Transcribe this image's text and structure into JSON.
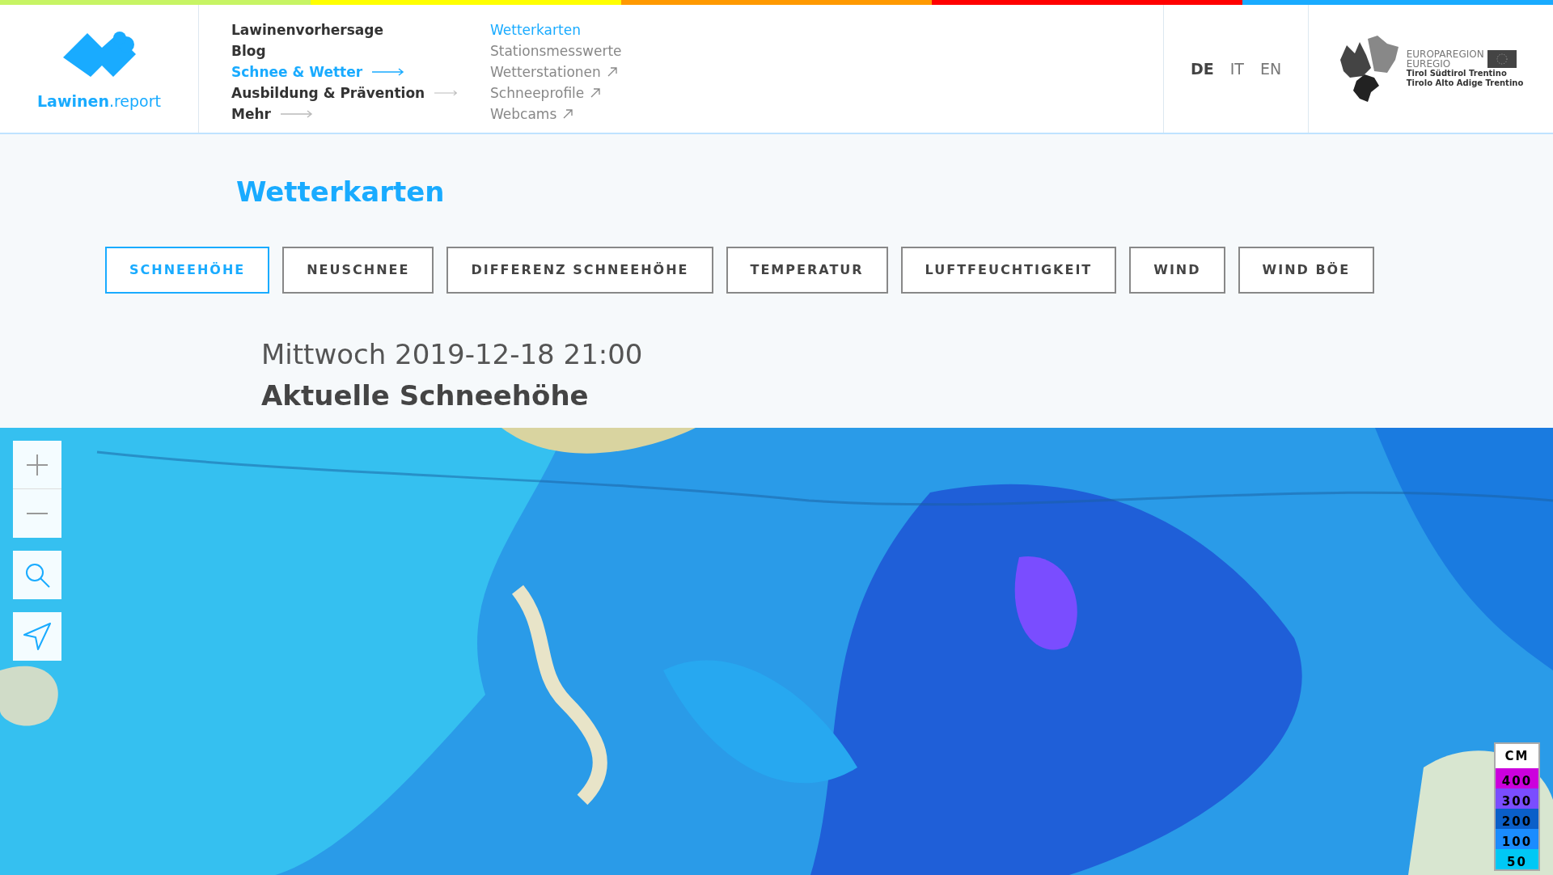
{
  "brand": {
    "name_bold": "Lawinen",
    "name_light": ".report"
  },
  "nav_main": [
    {
      "label": "Lawinenvorhersage",
      "selected": false,
      "arrow": false
    },
    {
      "label": "Blog",
      "selected": false,
      "arrow": false
    },
    {
      "label": "Schnee & Wetter",
      "selected": true,
      "arrow": true
    },
    {
      "label": "Ausbildung & Prävention",
      "selected": false,
      "arrow": true
    },
    {
      "label": "Mehr",
      "selected": false,
      "arrow": true
    }
  ],
  "nav_sub": [
    {
      "label": "Wetterkarten",
      "selected": true,
      "external": false
    },
    {
      "label": "Stationsmesswerte",
      "selected": false,
      "external": false
    },
    {
      "label": "Wetterstationen",
      "selected": false,
      "external": true
    },
    {
      "label": "Schneeprofile",
      "selected": false,
      "external": true
    },
    {
      "label": "Webcams",
      "selected": false,
      "external": true
    }
  ],
  "languages": [
    {
      "label": "DE",
      "selected": true
    },
    {
      "label": "IT",
      "selected": false
    },
    {
      "label": "EN",
      "selected": false
    }
  ],
  "partner_logo": {
    "lines": [
      "EUROPAREGION",
      "EUREGIO",
      "Tirol Südtirol Trentino",
      "Tirolo Alto Adige Trentino"
    ]
  },
  "page_title": "Wetterkarten",
  "tabs": [
    {
      "label": "SCHNEEHÖHE",
      "selected": true
    },
    {
      "label": "NEUSCHNEE",
      "selected": false
    },
    {
      "label": "DIFFERENZ SCHNEEHÖHE",
      "selected": false
    },
    {
      "label": "TEMPERATUR",
      "selected": false
    },
    {
      "label": "LUFTFEUCHTIGKEIT",
      "selected": false
    },
    {
      "label": "WIND",
      "selected": false
    },
    {
      "label": "WIND BÖE",
      "selected": false
    }
  ],
  "timestamp": "Mittwoch 2019-12-18 21:00",
  "map_title": "Aktuelle Schneehöhe",
  "legend": {
    "unit": "CM",
    "items": [
      {
        "label": "400",
        "color": "#cc00dd"
      },
      {
        "label": "300",
        "color": "#7a4dff"
      },
      {
        "label": "200",
        "color": "#0a5fc9"
      },
      {
        "label": "100",
        "color": "#1a8cff"
      },
      {
        "label": "50",
        "color": "#00c8f5"
      }
    ]
  }
}
